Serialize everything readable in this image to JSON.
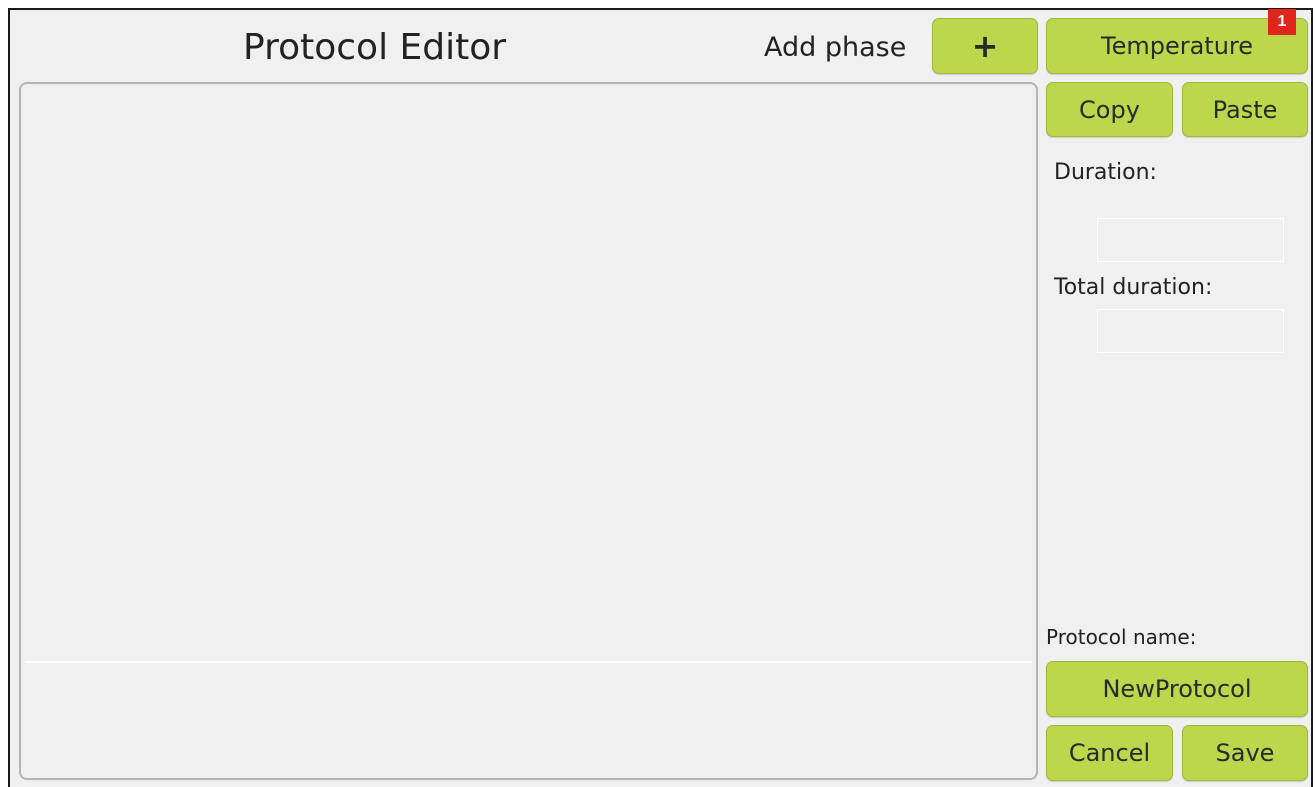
{
  "header": {
    "title": "Protocol Editor",
    "add_phase_label": "Add phase",
    "add_phase_button_glyph": "+"
  },
  "sidebar": {
    "temperature_label": "Temperature",
    "copy_label": "Copy",
    "paste_label": "Paste",
    "duration_label": "Duration:",
    "duration_value": "",
    "total_duration_label": "Total duration:",
    "total_duration_value": "",
    "protocol_name_label": "Protocol name:",
    "protocol_name_value": "NewProtocol",
    "cancel_label": "Cancel",
    "save_label": "Save"
  },
  "annotation": {
    "badge": "1",
    "badge_color": "#e0261c"
  },
  "colors": {
    "button_fill": "#bcd74b",
    "background": "#f0f0f0"
  }
}
